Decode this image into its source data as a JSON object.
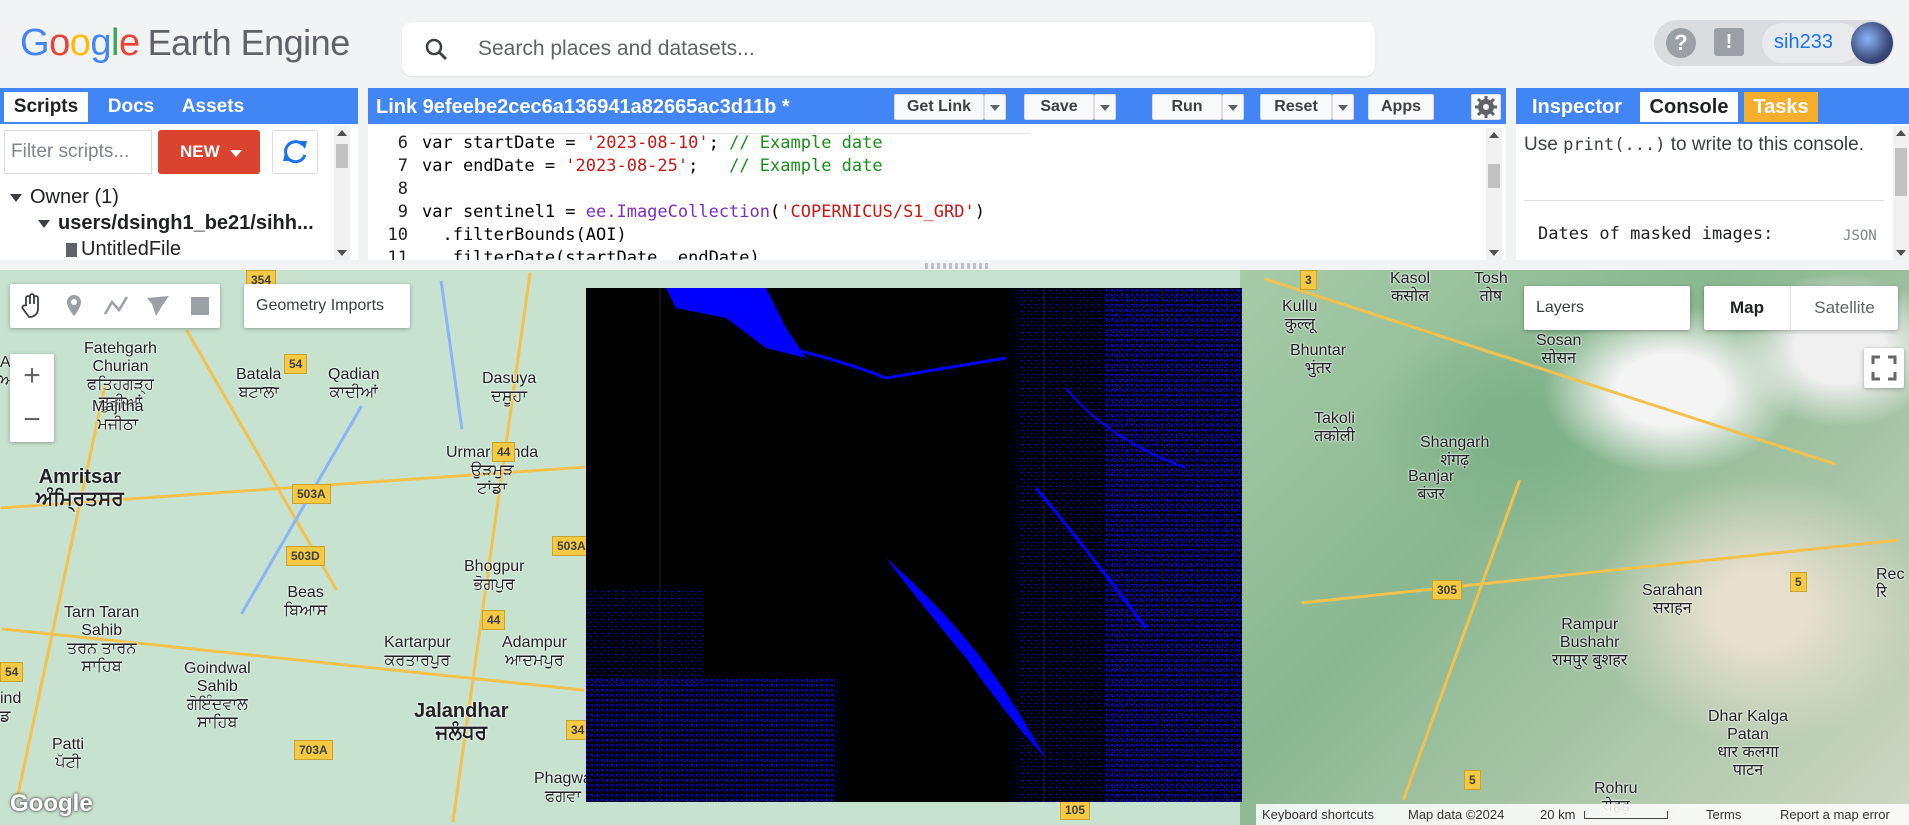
{
  "header": {
    "logo_letters": [
      "G",
      "o",
      "o",
      "g",
      "l",
      "e"
    ],
    "product": "Earth Engine",
    "search_placeholder": "Search places and datasets...",
    "help_label": "?",
    "feedback_label": "!",
    "username": "sih233"
  },
  "left_panel": {
    "tabs": [
      {
        "label": "Scripts",
        "active": true
      },
      {
        "label": "Docs",
        "active": false
      },
      {
        "label": "Assets",
        "active": false
      }
    ],
    "filter_placeholder": "Filter scripts...",
    "new_label": "NEW",
    "tree": [
      {
        "label": "Owner (1)",
        "expanded": true
      },
      {
        "label": "users/dsingh1_be21/sihh...",
        "expanded": true
      },
      {
        "label": "UntitledFile"
      }
    ]
  },
  "editor": {
    "title": "Link 9efeebe2cec6a136941a82665ac3d11b *",
    "buttons": {
      "get_link": "Get Link",
      "save": "Save",
      "run": "Run",
      "reset": "Reset",
      "apps": "Apps"
    },
    "lines": [
      {
        "num": "6",
        "pre": "var startDate = ",
        "str": "'2023-08-10'",
        "post": "; ",
        "cmt": "// Example date"
      },
      {
        "num": "7",
        "pre": "var endDate = ",
        "str": "'2023-08-25'",
        "post": ";   ",
        "cmt": "// Example date"
      },
      {
        "num": "8",
        "pre": "",
        "str": "",
        "post": "",
        "cmt": ""
      },
      {
        "num": "9",
        "pre": "var sentinel1 = ",
        "fn": "ee.ImageCollection",
        "open": "(",
        "str": "'COPERNICUS/S1_GRD'",
        "post": ")",
        "cmt": ""
      },
      {
        "num": "10",
        "pre": "  .filterBounds(AOI)",
        "str": "",
        "post": "",
        "cmt": ""
      },
      {
        "num": "11",
        "pre": "  .filterDate(startDate, endDate)",
        "str": "",
        "post": "",
        "cmt": ""
      }
    ]
  },
  "right_panel": {
    "tabs": [
      {
        "label": "Inspector",
        "active": false
      },
      {
        "label": "Console",
        "active": true
      },
      {
        "label": "Tasks",
        "active": false
      }
    ],
    "console_msg_pre": "Use ",
    "console_msg_code": "print(...)",
    "console_msg_post": " to write to this console.",
    "output_label": "Dates of masked images:",
    "output_type": "JSON"
  },
  "map": {
    "geometry_imports": "Geometry Imports",
    "zoom_in": "+",
    "zoom_out": "−",
    "layers": "Layers",
    "map_type_map": "Map",
    "map_type_satellite": "Satellite",
    "watermark": "Google",
    "attribution": {
      "shortcuts": "Keyboard shortcuts",
      "map_data": "Map data ©2024",
      "scale": "20 km",
      "terms": "Terms",
      "report": "Report a map error"
    },
    "places": [
      {
        "name": "Fatehgarh\nChurian\nਫਤਿਹਗੜ੍ਹ\nਚੂੜੀਆਂ"
      },
      {
        "name": "Batala\nਬਟਾਲਾ"
      },
      {
        "name": "Qadian\nਕਾਦੀਆਂ"
      },
      {
        "name": "Dasuya\nਦਸੂਹਾ"
      },
      {
        "name": "Majitha\nਮਜੀਠਾ"
      },
      {
        "name": "Amritsar\nਅੰਮ੍ਰਿਤਸਰ"
      },
      {
        "name": "Urmar Tanda\nਉੜਮੁੜ\nਟਾਂਡਾ"
      },
      {
        "name": "Bhogpur\nਭੋਗਪੁਰ"
      },
      {
        "name": "Beas\nਬਿਆਸ"
      },
      {
        "name": "Tarn Taran\nSahib\nਤਰਨ ਤਾਰਨ\nਸਾਹਿਬ"
      },
      {
        "name": "Kartarpur\nਕਰਤਾਰਪੁਰ"
      },
      {
        "name": "Adampur\nਆਦਮਪੁਰ"
      },
      {
        "name": "Goindwal\nSahib\nਗੋਇੰਦਵਾਲ\nਸਾਹਿਬ"
      },
      {
        "name": "Jalandhar\nਜਲੰਧਰ"
      },
      {
        "name": "Patti\nਪੱਟੀ"
      },
      {
        "name": "Phagwa\nਫਗਵਾ"
      },
      {
        "name": "Kullu\nकुल्लू"
      },
      {
        "name": "Bhuntar\nभुंतर"
      },
      {
        "name": "Takoli\nतकोली"
      },
      {
        "name": "Shangarh\nशंगढ़"
      },
      {
        "name": "Banjar\nबंजर"
      },
      {
        "name": "Sosan\nसोसन"
      },
      {
        "name": "Sarahan\nसराहन"
      },
      {
        "name": "Rampur\nBushahr\nरामपुर बुशहर"
      },
      {
        "name": "Dhar Kalga\nPatan\nधार कलगा\nपाटन"
      },
      {
        "name": "Rohru\nरोहड़"
      },
      {
        "name": "Kasol\nकसोल"
      },
      {
        "name": "Tosh\nतोष"
      },
      {
        "name": "Aj\nਅ"
      },
      {
        "name": "ind\nਡ"
      },
      {
        "name": "Rec\nरि"
      }
    ],
    "shields": [
      "354",
      "54",
      "44",
      "503A",
      "503D",
      "44",
      "503A",
      "703A",
      "34",
      "54",
      "105",
      "305",
      "5",
      "5",
      "3"
    ]
  }
}
